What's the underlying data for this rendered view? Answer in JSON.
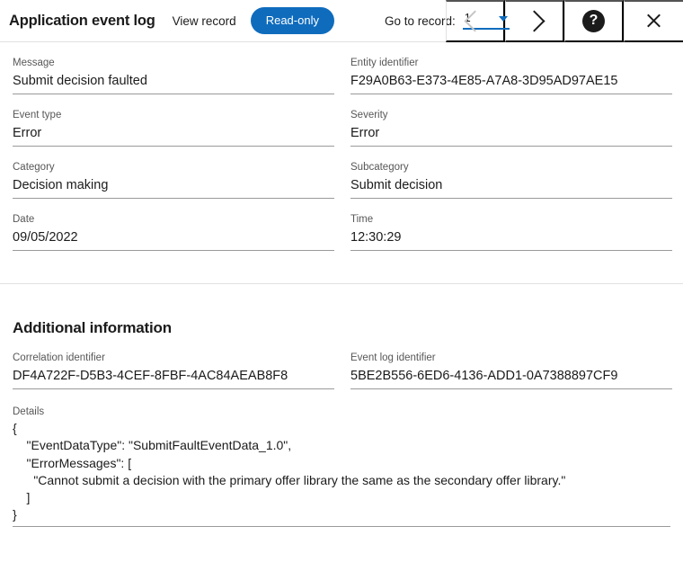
{
  "header": {
    "app_title": "Application event log",
    "mode_label": "View record",
    "readonly_badge": "Read-only",
    "goto_label": "Go to record:",
    "record_value": "1",
    "prev_icon": "chevron-left-icon",
    "next_icon": "chevron-right-icon",
    "help_icon": "question-mark-icon",
    "help_glyph": "?",
    "close_icon": "close-icon",
    "accent_color": "#0f6cbd"
  },
  "main_fields": [
    {
      "label": "Message",
      "value": "Submit decision faulted"
    },
    {
      "label": "Entity identifier",
      "value": "F29A0B63-E373-4E85-A7A8-3D95AD97AE15"
    },
    {
      "label": "Event type",
      "value": "Error"
    },
    {
      "label": "Severity",
      "value": "Error"
    },
    {
      "label": "Category",
      "value": "Decision making"
    },
    {
      "label": "Subcategory",
      "value": "Submit decision"
    },
    {
      "label": "Date",
      "value": "09/05/2022"
    },
    {
      "label": "Time",
      "value": "12:30:29"
    }
  ],
  "additional": {
    "section_title": "Additional information",
    "correlation_label": "Correlation identifier",
    "correlation_value": "DF4A722F-D5B3-4CEF-8FBF-4AC84AEAB8F8",
    "eventlog_label": "Event log identifier",
    "eventlog_value": "5BE2B556-6ED6-4136-ADD1-0A7388897CF9",
    "details_label": "Details",
    "details_value": "{\n    \"EventDataType\": \"SubmitFaultEventData_1.0\",\n    \"ErrorMessages\": [\n      \"Cannot submit a decision with the primary offer library the same as the secondary offer library.\"\n    ]\n}"
  }
}
